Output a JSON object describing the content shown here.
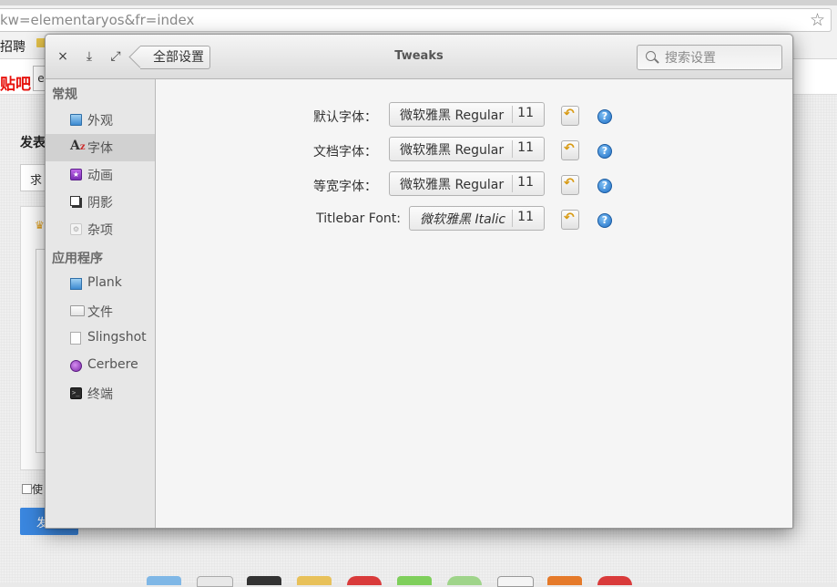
{
  "browser": {
    "url": "kw=elementaryos&fr=index",
    "bookmarks_text": "招聘",
    "tieba_logo": "贴吧",
    "search_stub": "e",
    "post_label": "发表",
    "select_text": "求",
    "checkbox_text": "使",
    "submit_text": "发"
  },
  "window": {
    "title": "Tweaks",
    "close_glyph": "×",
    "minimize_glyph": "⤓",
    "maximize_glyph": "⤢",
    "back_label": "全部设置",
    "search_placeholder": "搜索设置"
  },
  "sidebar": {
    "categories": [
      "常规",
      "应用程序"
    ],
    "items": [
      {
        "label": "外观",
        "icon": "appearance-icon",
        "selected": false
      },
      {
        "label": "字体",
        "icon": "font-icon",
        "selected": true
      },
      {
        "label": "动画",
        "icon": "animation-icon",
        "selected": false
      },
      {
        "label": "阴影",
        "icon": "shadow-icon",
        "selected": false
      },
      {
        "label": "杂项",
        "icon": "misc-icon",
        "selected": false
      },
      {
        "label": "Plank",
        "icon": "plank-icon",
        "selected": false
      },
      {
        "label": "文件",
        "icon": "files-icon",
        "selected": false
      },
      {
        "label": "Slingshot",
        "icon": "slingshot-icon",
        "selected": false
      },
      {
        "label": "Cerbere",
        "icon": "cerbere-icon",
        "selected": false
      },
      {
        "label": "终端",
        "icon": "terminal-icon",
        "selected": false
      }
    ]
  },
  "fonts": {
    "rows": [
      {
        "label": "默认字体：",
        "font": "微软雅黑 Regular",
        "size": "11",
        "italic": false
      },
      {
        "label": "文档字体：",
        "font": "微软雅黑 Regular",
        "size": "11",
        "italic": false
      },
      {
        "label": "等宽字体：",
        "font": "微软雅黑 Regular",
        "size": "11",
        "italic": false
      },
      {
        "label": "Titlebar Font:",
        "font": "微软雅黑 Italic",
        "size": "11",
        "italic": true
      }
    ],
    "revert_glyph": "↶",
    "help_glyph": "?"
  },
  "colors": {
    "accent": "#3a86de",
    "revert": "#d89a13",
    "help": "#1f6fc5",
    "selected_row": "#d1d1d1"
  }
}
